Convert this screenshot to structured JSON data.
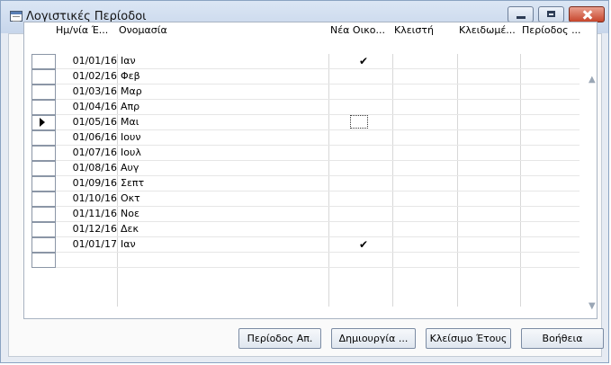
{
  "window": {
    "title": "Λογιστικές Περίοδοι"
  },
  "table": {
    "columns": [
      "Ημ/νία Έ...",
      "Ονομασία",
      "Νέα Οικο...",
      "Κλειστή",
      "Κλειδωμέ...",
      "Περίοδος ..."
    ],
    "rows": [
      {
        "date": "01/01/16",
        "name": "Ιαν",
        "new_fiscal": true
      },
      {
        "date": "01/02/16",
        "name": "Φεβ",
        "new_fiscal": false
      },
      {
        "date": "01/03/16",
        "name": "Μαρ",
        "new_fiscal": false
      },
      {
        "date": "01/04/16",
        "name": "Απρ",
        "new_fiscal": false
      },
      {
        "date": "01/05/16",
        "name": "Μαι",
        "new_fiscal": false,
        "current": true
      },
      {
        "date": "01/06/16",
        "name": "Ιουν",
        "new_fiscal": false
      },
      {
        "date": "01/07/16",
        "name": "Ιουλ",
        "new_fiscal": false
      },
      {
        "date": "01/08/16",
        "name": "Αυγ",
        "new_fiscal": false
      },
      {
        "date": "01/09/16",
        "name": "Σεπτ",
        "new_fiscal": false
      },
      {
        "date": "01/10/16",
        "name": "Οκτ",
        "new_fiscal": false
      },
      {
        "date": "01/11/16",
        "name": "Νοε",
        "new_fiscal": false
      },
      {
        "date": "01/12/16",
        "name": "Δεκ",
        "new_fiscal": false
      },
      {
        "date": "01/01/17",
        "name": "Ιαν",
        "new_fiscal": true
      }
    ]
  },
  "buttons": {
    "period": "Περίοδος Απ.",
    "create": "Δημιουργία ...",
    "close_year": "Κλείσιμο Έτους",
    "help": "Βοήθεια"
  },
  "glyphs": {
    "check": "✔",
    "row_pointer": "▶",
    "scroll_up": "▲",
    "scroll_down": "▼"
  }
}
